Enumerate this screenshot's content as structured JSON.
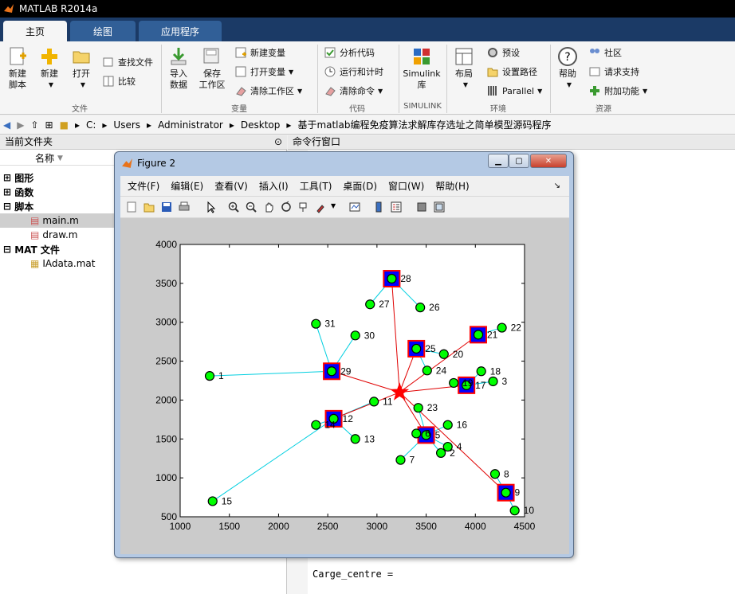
{
  "app": {
    "title": "MATLAB R2014a"
  },
  "tabs": [
    "主页",
    "绘图",
    "应用程序"
  ],
  "ribbon": {
    "new_script": "新建\n脚本",
    "new": "新建",
    "open": "打开",
    "find_files": "查找文件",
    "compare": "比较",
    "import": "导入\n数据",
    "save_ws": "保存\n工作区",
    "new_var": "新建变量",
    "open_var": "打开变量",
    "clear_ws": "清除工作区",
    "analyze": "分析代码",
    "run_time": "运行和计时",
    "clear_cmd": "清除命令",
    "simulink": "Simulink\n库",
    "layout": "布局",
    "prefs": "预设",
    "set_path": "设置路径",
    "parallel": "Parallel",
    "help": "帮助",
    "community": "社区",
    "request": "请求支持",
    "addons": "附加功能",
    "groups": [
      "文件",
      "变量",
      "代码",
      "SIMULINK",
      "环境",
      "资源"
    ]
  },
  "address": {
    "parts": [
      "C:",
      "Users",
      "Administrator",
      "Desktop",
      "基于matlab编程免疫算法求解库存选址之简单模型源码程序"
    ]
  },
  "left": {
    "header": "当前文件夹",
    "col": "名称",
    "items": [
      "图形",
      "函数",
      "脚本",
      "main.m",
      "draw.m",
      "MAT 文件",
      "IAdata.mat"
    ]
  },
  "cmd": {
    "header": "命令行窗口",
    "text": "Carge_centre ="
  },
  "figure": {
    "title": "Figure 2",
    "menu": [
      "文件(F)",
      "编辑(E)",
      "查看(V)",
      "插入(I)",
      "工具(T)",
      "桌面(D)",
      "窗口(W)",
      "帮助(H)"
    ],
    "corner": "↘"
  },
  "chart_data": {
    "type": "scatter",
    "xlim": [
      1000,
      4500
    ],
    "ylim": [
      500,
      4000
    ],
    "xticks": [
      1000,
      1500,
      2000,
      2500,
      3000,
      3500,
      4000,
      4500
    ],
    "yticks": [
      500,
      1000,
      1500,
      2000,
      2500,
      3000,
      3500,
      4000
    ],
    "center": {
      "x": 3230,
      "y": 2100
    },
    "points": [
      {
        "id": "1",
        "x": 1300,
        "y": 2310
      },
      {
        "id": "2",
        "x": 3650,
        "y": 1320
      },
      {
        "id": "3",
        "x": 4180,
        "y": 2240
      },
      {
        "id": "4",
        "x": 3720,
        "y": 1400
      },
      {
        "id": "5",
        "x": 3500,
        "y": 1550
      },
      {
        "id": "6",
        "x": 3400,
        "y": 1570
      },
      {
        "id": "7",
        "x": 3240,
        "y": 1230
      },
      {
        "id": "8",
        "x": 4200,
        "y": 1050
      },
      {
        "id": "9",
        "x": 4310,
        "y": 810
      },
      {
        "id": "10",
        "x": 4400,
        "y": 580
      },
      {
        "id": "11",
        "x": 2970,
        "y": 1980
      },
      {
        "id": "12",
        "x": 2560,
        "y": 1760
      },
      {
        "id": "13",
        "x": 2780,
        "y": 1500
      },
      {
        "id": "14",
        "x": 2380,
        "y": 1680
      },
      {
        "id": "15",
        "x": 1330,
        "y": 700
      },
      {
        "id": "16",
        "x": 3720,
        "y": 1680
      },
      {
        "id": "17",
        "x": 3910,
        "y": 2190
      },
      {
        "id": "18",
        "x": 4060,
        "y": 2370
      },
      {
        "id": "19",
        "x": 3780,
        "y": 2220
      },
      {
        "id": "20",
        "x": 3680,
        "y": 2590
      },
      {
        "id": "21",
        "x": 4030,
        "y": 2840
      },
      {
        "id": "22",
        "x": 4270,
        "y": 2930
      },
      {
        "id": "23",
        "x": 3420,
        "y": 1900
      },
      {
        "id": "24",
        "x": 3510,
        "y": 2380
      },
      {
        "id": "25",
        "x": 3400,
        "y": 2660
      },
      {
        "id": "26",
        "x": 3440,
        "y": 3190
      },
      {
        "id": "27",
        "x": 2930,
        "y": 3230
      },
      {
        "id": "28",
        "x": 3150,
        "y": 3560
      },
      {
        "id": "29",
        "x": 2540,
        "y": 2370
      },
      {
        "id": "30",
        "x": 2780,
        "y": 2830
      },
      {
        "id": "31",
        "x": 2380,
        "y": 2980
      }
    ],
    "centers": [
      "12",
      "5",
      "17",
      "21",
      "25",
      "28",
      "29",
      "9"
    ],
    "assign": {
      "1": "29",
      "2": "5",
      "3": "17",
      "4": "5",
      "5": "5",
      "6": "5",
      "7": "5",
      "8": "9",
      "9": "9",
      "10": "9",
      "11": "12",
      "12": "12",
      "13": "12",
      "14": "12",
      "15": "12",
      "16": "5",
      "17": "17",
      "18": "17",
      "19": "17",
      "20": "25",
      "21": "21",
      "22": "21",
      "23": "5",
      "24": "25",
      "25": "25",
      "26": "28",
      "27": "28",
      "28": "28",
      "29": "29",
      "30": "29",
      "31": "29"
    }
  }
}
